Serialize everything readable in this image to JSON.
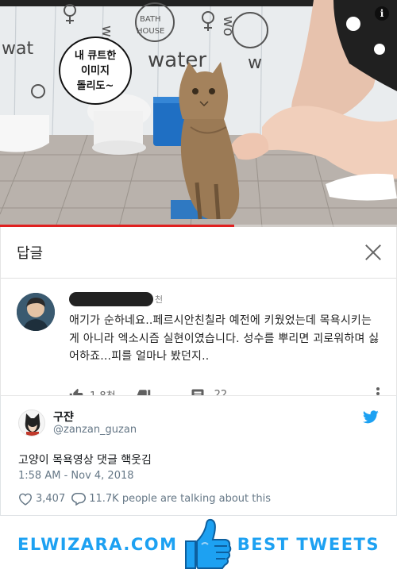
{
  "video": {
    "overlay_caption": "내 큐트한\n이미지\n돌리도~",
    "scene_text": [
      "BATH HOUSE",
      "water"
    ],
    "progress_fraction": 0.59,
    "info_icon": "info-icon"
  },
  "reply_panel": {
    "title": "답글",
    "close_icon": "close-icon",
    "comment": {
      "author_suffix": "천",
      "text": "애기가 순하네요..페르시안친칠라 예전에 키웠었는데 목욕시키는게 아니라 엑소시즘 실현이였습니다. 성수를 뿌리면 괴로워하며 싫어하죠...피를 얼마나 봤던지..",
      "like_count": "1.8천",
      "reply_count": "22"
    }
  },
  "tweet": {
    "display_name": "구쟌",
    "handle": "@zanzan_guzan",
    "text": "고양이 목욕영상 댓글 핵웃김",
    "timestamp": "1:58 AM - Nov 4, 2018",
    "likes": "3,407",
    "talking": "11.7K people are talking about this"
  },
  "footer": {
    "left_brand": "ELWIZARA.COM",
    "right_brand": "BEST TWEETS"
  },
  "colors": {
    "twitter_blue": "#1da1f2",
    "progress_red": "#e02020",
    "meta_gray": "#657786"
  }
}
